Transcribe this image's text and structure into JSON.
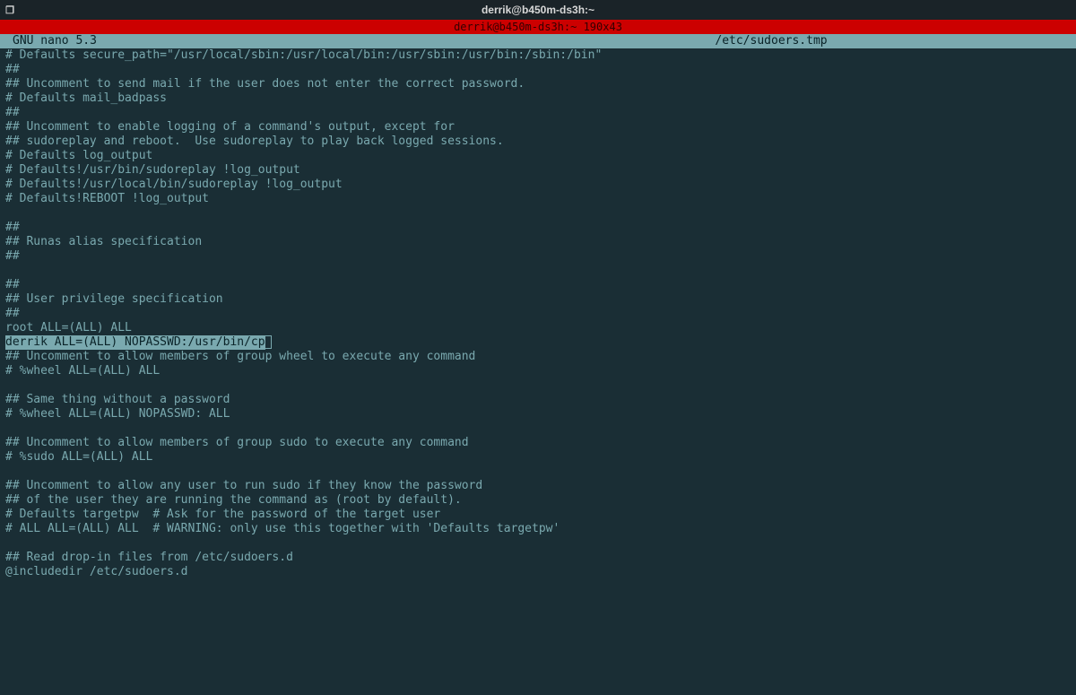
{
  "window": {
    "title": "derrik@b450m-ds3h:~",
    "app_icon_glyph": "❐"
  },
  "tmux": {
    "status": "derrik@b450m-ds3h:~ 190x43"
  },
  "nano": {
    "header_left": "GNU nano 5.3",
    "header_file": "/etc/sudoers.tmp"
  },
  "lines": [
    "# Defaults secure_path=\"/usr/local/sbin:/usr/local/bin:/usr/sbin:/usr/bin:/sbin:/bin\"",
    "##",
    "## Uncomment to send mail if the user does not enter the correct password.",
    "# Defaults mail_badpass",
    "##",
    "## Uncomment to enable logging of a command's output, except for",
    "## sudoreplay and reboot.  Use sudoreplay to play back logged sessions.",
    "# Defaults log_output",
    "# Defaults!/usr/bin/sudoreplay !log_output",
    "# Defaults!/usr/local/bin/sudoreplay !log_output",
    "# Defaults!REBOOT !log_output",
    "",
    "##",
    "## Runas alias specification",
    "##",
    "",
    "##",
    "## User privilege specification",
    "##",
    "root ALL=(ALL) ALL",
    "derrik ALL=(ALL) NOPASSWD:/usr/bin/cp",
    "## Uncomment to allow members of group wheel to execute any command",
    "# %wheel ALL=(ALL) ALL",
    "",
    "## Same thing without a password",
    "# %wheel ALL=(ALL) NOPASSWD: ALL",
    "",
    "## Uncomment to allow members of group sudo to execute any command",
    "# %sudo ALL=(ALL) ALL",
    "",
    "## Uncomment to allow any user to run sudo if they know the password",
    "## of the user they are running the command as (root by default).",
    "# Defaults targetpw  # Ask for the password of the target user",
    "# ALL ALL=(ALL) ALL  # WARNING: only use this together with 'Defaults targetpw'",
    "",
    "## Read drop-in files from /etc/sudoers.d",
    "@includedir /etc/sudoers.d"
  ],
  "highlight_index": 20
}
